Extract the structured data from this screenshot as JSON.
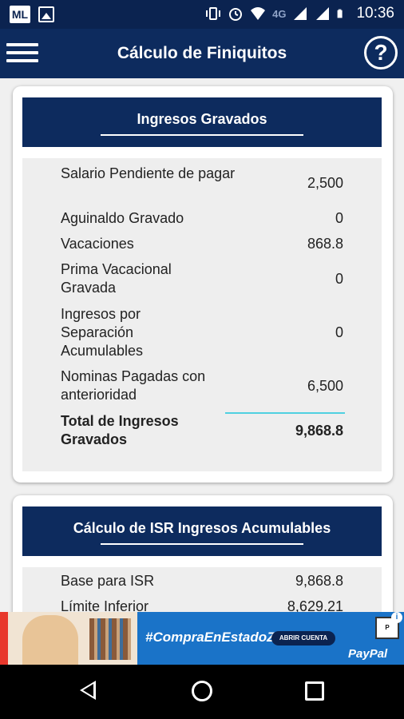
{
  "status_bar": {
    "left_badge": "ML",
    "network": "4G",
    "time": "10:36",
    "icons": [
      "ml-app-icon",
      "gallery-icon",
      "vibrate-icon",
      "alarm-icon",
      "wifi-icon",
      "signal-icon",
      "signal-icon",
      "battery-icon"
    ]
  },
  "app_bar": {
    "title": "Cálculo de Finiquitos",
    "help_label": "?"
  },
  "ingresos_gravados": {
    "title": "Ingresos Gravados",
    "rows": [
      {
        "label": "Salario Pendiente de pagar",
        "value": "2,500"
      },
      {
        "label": "Aguinaldo Gravado",
        "value": "0"
      },
      {
        "label": "Vacaciones",
        "value": "868.8"
      },
      {
        "label": "Prima Vacacional Gravada",
        "value": "0"
      },
      {
        "label": "Ingresos por Separación Acumulables",
        "value": "0"
      },
      {
        "label": "Nominas Pagadas con anterioridad",
        "value": "6,500"
      }
    ],
    "total": {
      "label": "Total de Ingresos Gravados",
      "value": "9,868.8"
    }
  },
  "isr_acumulables": {
    "title": "Cálculo de ISR Ingresos Acumulables",
    "rows": [
      {
        "label": "Base para ISR",
        "value": "9,868.8"
      },
      {
        "label": "Límite Inferior",
        "value": "8,629.21"
      }
    ]
  },
  "ad": {
    "hashtag": "#CompraEnEstadoZen",
    "cta": "ABRIR CUENTA",
    "brand": "PayPal",
    "info": "i",
    "logo_text": "P"
  },
  "colors": {
    "primary": "#0d2b5e",
    "accent_line": "#4fd0e0",
    "ad_bg": "#1a73c8"
  }
}
